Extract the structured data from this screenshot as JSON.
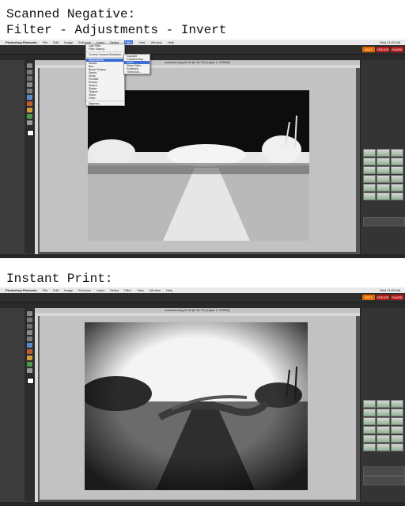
{
  "captions": {
    "top_line1": "Scanned Negative:",
    "top_line2": "Filter - Adjustments - Invert",
    "bottom_line1": "Instant Print:"
  },
  "app": {
    "menubar": [
      "Photoshop Elements",
      "File",
      "Edit",
      "Image",
      "Enhance",
      "Layer",
      "Select",
      "Filter",
      "View",
      "Window",
      "Help"
    ],
    "clock": "Wed 11:00 AM",
    "mode_buttons": {
      "edit": "EDIT",
      "create": "CREATE",
      "share": "SHARE"
    },
    "doc_tab_title": "scanned-neg-01.tif @ 16.7% (Layer 1, RGB/8)"
  },
  "filter_menu": {
    "items": [
      "Last Filter",
      "Filter Gallery...",
      "Correct Camera Distortion...",
      "Adjustments",
      "Artistic",
      "Blur",
      "Brush Strokes",
      "Distort",
      "Noise",
      "Pixelate",
      "Render",
      "Sketch",
      "Stylize",
      "Texture",
      "Video",
      "Other",
      "Digimarc"
    ],
    "highlighted": "Adjustments"
  },
  "adjustments_submenu": {
    "items": [
      "Equalize",
      "Gradient Map...",
      "Invert",
      "Photo Filter...",
      "Posterize...",
      "Threshold..."
    ],
    "highlighted": "Invert"
  },
  "colors": {
    "accent_edit": "#e06a00",
    "accent_create": "#b71a1a",
    "menu_highlight": "#3b6fd6"
  }
}
